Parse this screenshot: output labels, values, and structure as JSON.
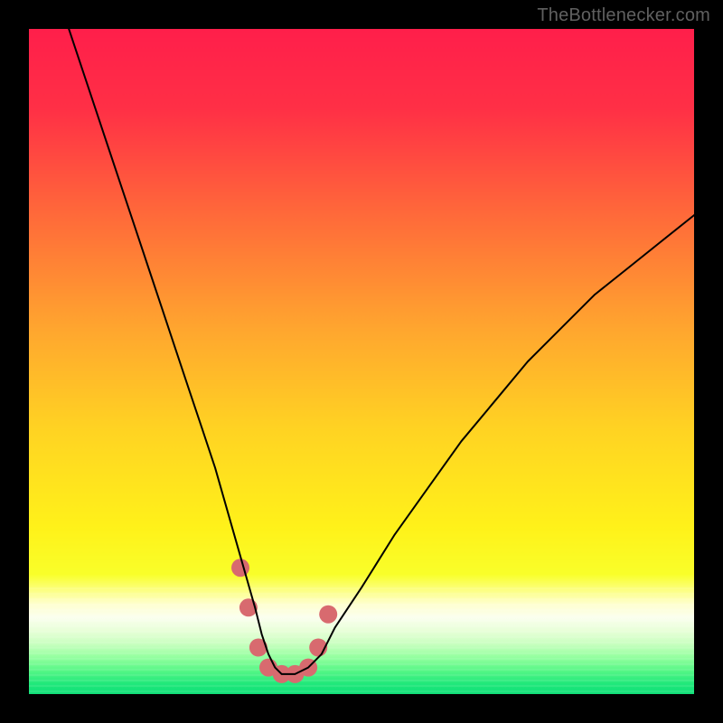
{
  "watermark": "TheBottlenecker.com",
  "chart_data": {
    "type": "line",
    "title": "",
    "xlabel": "",
    "ylabel": "",
    "xlim": [
      0,
      100
    ],
    "ylim": [
      0,
      100
    ],
    "background_gradient": {
      "direction": "vertical",
      "stops": [
        {
          "pos": 0.0,
          "color": "#ff1f4b"
        },
        {
          "pos": 0.12,
          "color": "#ff3046"
        },
        {
          "pos": 0.28,
          "color": "#ff6a3a"
        },
        {
          "pos": 0.45,
          "color": "#ffa62f"
        },
        {
          "pos": 0.6,
          "color": "#ffd323"
        },
        {
          "pos": 0.75,
          "color": "#fff21a"
        },
        {
          "pos": 0.82,
          "color": "#f9ff2a"
        },
        {
          "pos": 0.865,
          "color": "#ffffd0"
        },
        {
          "pos": 0.885,
          "color": "#fbffef"
        },
        {
          "pos": 0.905,
          "color": "#e8ffd8"
        },
        {
          "pos": 0.925,
          "color": "#c8ffbf"
        },
        {
          "pos": 0.945,
          "color": "#93ff9f"
        },
        {
          "pos": 0.965,
          "color": "#55f786"
        },
        {
          "pos": 0.985,
          "color": "#1fe87a"
        },
        {
          "pos": 1.0,
          "color": "#10df78"
        }
      ]
    },
    "series": [
      {
        "name": "bottleneck-curve",
        "color": "#000000",
        "width": 2,
        "x": [
          6,
          8,
          10,
          12,
          14,
          16,
          18,
          20,
          22,
          24,
          26,
          28,
          30,
          32,
          34,
          35,
          36,
          37,
          38,
          39,
          40,
          42,
          44,
          46,
          50,
          55,
          60,
          65,
          70,
          75,
          80,
          85,
          90,
          95,
          100
        ],
        "y": [
          100,
          94,
          88,
          82,
          76,
          70,
          64,
          58,
          52,
          46,
          40,
          34,
          27,
          20,
          13,
          9,
          6,
          4,
          3,
          3,
          3,
          4,
          6,
          10,
          16,
          24,
          31,
          38,
          44,
          50,
          55,
          60,
          64,
          68,
          72
        ]
      }
    ],
    "markers": {
      "color": "#d86a6f",
      "radius": 10,
      "points": [
        {
          "x": 31.8,
          "y": 19
        },
        {
          "x": 33.0,
          "y": 13
        },
        {
          "x": 34.5,
          "y": 7
        },
        {
          "x": 36.0,
          "y": 4
        },
        {
          "x": 38.0,
          "y": 3
        },
        {
          "x": 40.0,
          "y": 3
        },
        {
          "x": 42.0,
          "y": 4
        },
        {
          "x": 43.5,
          "y": 7
        },
        {
          "x": 45.0,
          "y": 12
        }
      ]
    }
  }
}
